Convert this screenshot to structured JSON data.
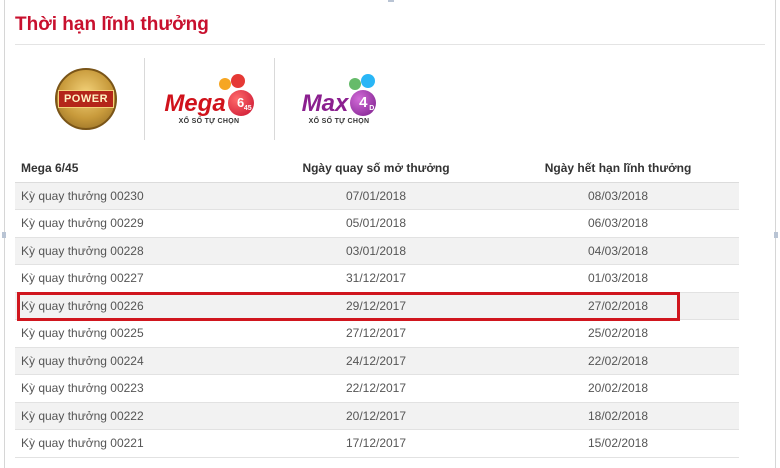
{
  "page": {
    "title": "Thời hạn lĩnh thưởng"
  },
  "logos": {
    "power": {
      "text": "POWER",
      "icon": "power-655-logo"
    },
    "mega": {
      "text": "Mega",
      "ball": "6",
      "ball_sub": "45",
      "tagline": "XỔ SỐ TỰ CHỌN",
      "icon": "mega-645-logo"
    },
    "max": {
      "text": "Max",
      "ball": "4",
      "ball_sub": "D",
      "tagline": "XỔ SỐ TỰ CHỌN",
      "icon": "max-4d-logo"
    }
  },
  "table": {
    "headers": {
      "draw": "Mega 6/45",
      "draw_date": "Ngày quay số mở thưởng",
      "expire_date": "Ngày hết hạn lĩnh thưởng"
    },
    "rows": [
      {
        "draw": "Kỳ quay thưởng 00230",
        "draw_date": "07/01/2018",
        "expire_date": "08/03/2018"
      },
      {
        "draw": "Kỳ quay thưởng 00229",
        "draw_date": "05/01/2018",
        "expire_date": "06/03/2018"
      },
      {
        "draw": "Kỳ quay thưởng 00228",
        "draw_date": "03/01/2018",
        "expire_date": "04/03/2018"
      },
      {
        "draw": "Kỳ quay thưởng 00227",
        "draw_date": "31/12/2017",
        "expire_date": "01/03/2018"
      },
      {
        "draw": "Kỳ quay thưởng 00226",
        "draw_date": "29/12/2017",
        "expire_date": "27/02/2018"
      },
      {
        "draw": "Kỳ quay thưởng 00225",
        "draw_date": "27/12/2017",
        "expire_date": "25/02/2018"
      },
      {
        "draw": "Kỳ quay thưởng 00224",
        "draw_date": "24/12/2017",
        "expire_date": "22/02/2018"
      },
      {
        "draw": "Kỳ quay thưởng 00223",
        "draw_date": "22/12/2017",
        "expire_date": "20/02/2018"
      },
      {
        "draw": "Kỳ quay thưởng 00222",
        "draw_date": "20/12/2017",
        "expire_date": "18/02/2018"
      },
      {
        "draw": "Kỳ quay thưởng 00221",
        "draw_date": "17/12/2017",
        "expire_date": "15/02/2018"
      }
    ],
    "highlighted_row": 4
  },
  "colors": {
    "title": "#c8102e",
    "highlight": "#d0161e",
    "row_alt": "#f2f2f2"
  }
}
